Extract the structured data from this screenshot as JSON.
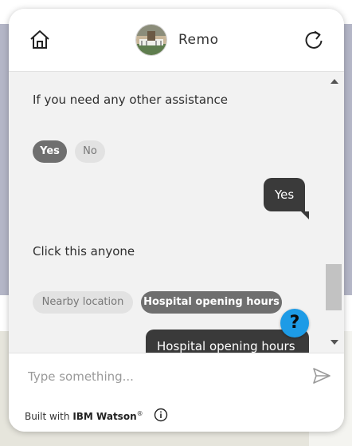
{
  "header": {
    "bot_name": "Remo",
    "home_icon": "home-icon",
    "refresh_icon": "refresh-icon",
    "avatar": "bot-avatar"
  },
  "messages": [
    {
      "type": "bot",
      "text": "If you need any other assistance"
    },
    {
      "type": "options",
      "options": [
        {
          "label": "Yes",
          "selected": true
        },
        {
          "label": "No",
          "selected": false
        }
      ]
    },
    {
      "type": "user",
      "text": "Yes"
    },
    {
      "type": "bot",
      "text": "Click this anyone"
    },
    {
      "type": "options",
      "options": [
        {
          "label": "Nearby location",
          "selected": false
        },
        {
          "label": "Hospital opening hours",
          "selected": true
        }
      ]
    },
    {
      "type": "user",
      "text": "Hospital opening hours"
    }
  ],
  "help_label": "?",
  "input": {
    "placeholder": "Type something...",
    "value": ""
  },
  "footer": {
    "prefix": "Built with ",
    "brand": "IBM Watson",
    "mark": "®"
  },
  "colors": {
    "selected_chip": "#6f6f6f",
    "user_bubble": "#3a3a3a",
    "help_button": "#1d9be6",
    "message_panel": "#f2f2f2"
  }
}
